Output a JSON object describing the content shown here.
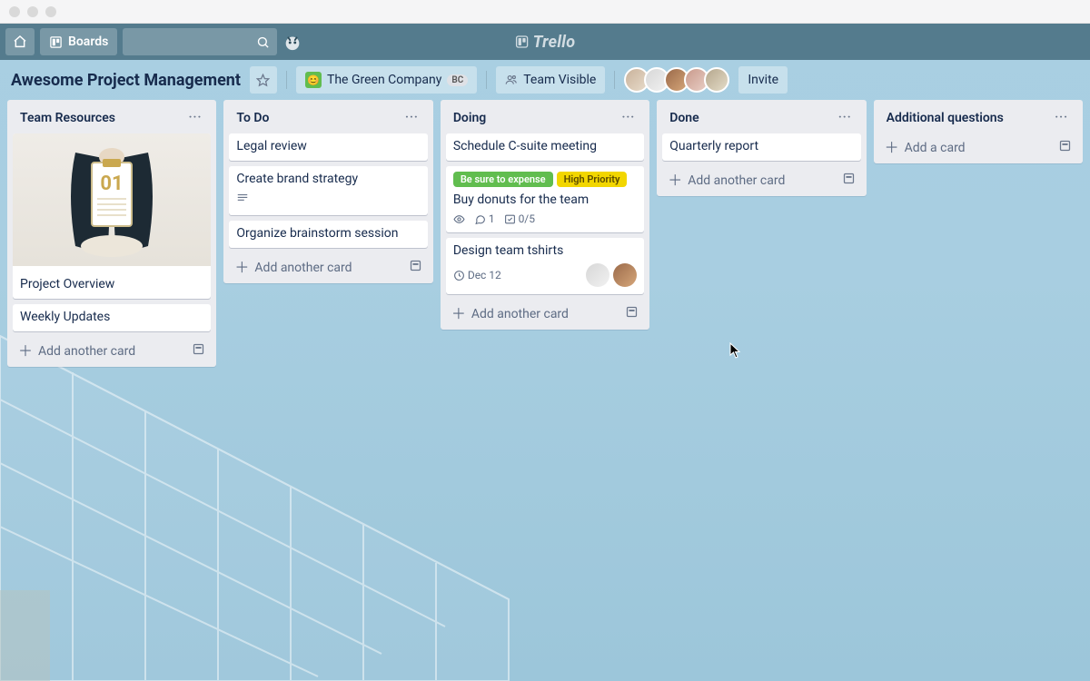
{
  "brand": "Trello",
  "topnav": {
    "boards_label": "Boards"
  },
  "board_header": {
    "title": "Awesome Project Management",
    "team_name": "The Green Company",
    "team_initials": "BC",
    "visibility": "Team Visible",
    "invite_label": "Invite"
  },
  "lists": [
    {
      "title": "Team Resources",
      "add_label": "Add another card",
      "cards": [
        {
          "text": "Project Overview",
          "cover": true,
          "cover_symbol": "01"
        },
        {
          "text": "Weekly Updates"
        }
      ]
    },
    {
      "title": "To Do",
      "add_label": "Add another card",
      "cards": [
        {
          "text": "Legal review"
        },
        {
          "text": "Create brand strategy",
          "has_description": true
        },
        {
          "text": "Organize brainstorm session"
        }
      ]
    },
    {
      "title": "Doing",
      "add_label": "Add another card",
      "cards": [
        {
          "text": "Schedule C-suite meeting"
        },
        {
          "text": "Buy donuts for the team",
          "labels": [
            {
              "text": "Be sure to expense",
              "color": "green"
            },
            {
              "text": "High Priority",
              "color": "yellow"
            }
          ],
          "badges": {
            "watch": true,
            "comments": "1",
            "checklist": "0/5"
          }
        },
        {
          "text": "Design team tshirts",
          "badges": {
            "due": "Dec 12"
          },
          "members": 2
        }
      ]
    },
    {
      "title": "Done",
      "add_label": "Add another card",
      "cards": [
        {
          "text": "Quarterly report"
        }
      ]
    },
    {
      "title": "Additional questions",
      "add_label": "Add a card",
      "cards": []
    }
  ]
}
